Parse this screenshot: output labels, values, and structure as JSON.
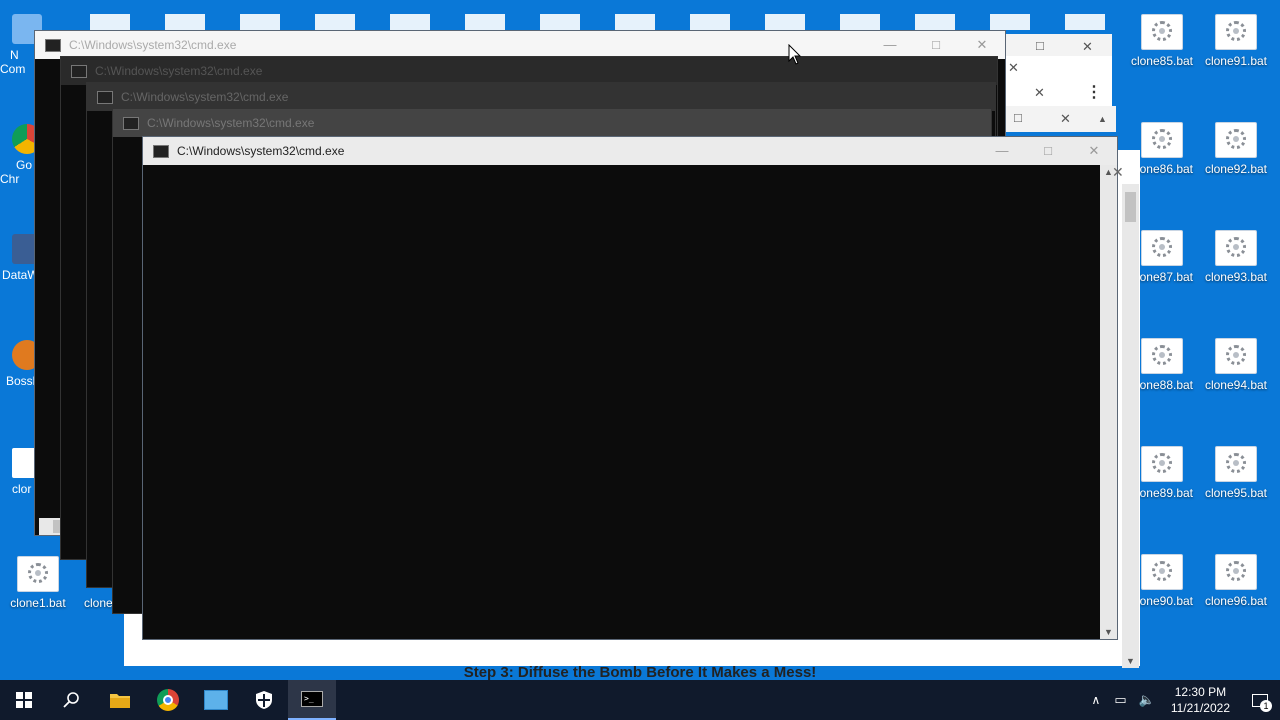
{
  "desktop": {
    "right_icons_col1": [
      "clone85.bat",
      "clone86.bat",
      "clone87.bat",
      "clone88.bat",
      "clone89.bat",
      "clone90.bat"
    ],
    "right_icons_col2": [
      "clone91.bat",
      "clone92.bat",
      "clone93.bat",
      "clone94.bat",
      "clone95.bat",
      "clone96.bat"
    ],
    "left_items": [
      {
        "label": "N\nCom",
        "name": "this-pc"
      },
      {
        "label": "Go\nChr",
        "name": "google-chrome"
      },
      {
        "label": "DataW",
        "name": "datawiper"
      },
      {
        "label": "Bossl",
        "name": "bossbus"
      },
      {
        "label": "clor",
        "name": "clone-left"
      },
      {
        "label": "clone1.bat",
        "name": "clone1"
      }
    ],
    "partial_icons": [
      "clone",
      "t"
    ]
  },
  "windows": {
    "cmd_title": "C:\\Windows\\system32\\cmd.exe",
    "controls": {
      "minimize": "—",
      "maximize": "□",
      "close": "✕"
    }
  },
  "banner": {
    "text": "Step 3: Diffuse the Bomb Before It Makes a Mess!"
  },
  "taskbar": {
    "items": [
      {
        "name": "start",
        "icon": "windows-icon"
      },
      {
        "name": "search",
        "icon": "search-icon"
      },
      {
        "name": "file-explorer",
        "icon": "folder-icon"
      },
      {
        "name": "chrome",
        "icon": "chrome-icon"
      },
      {
        "name": "control-panel",
        "icon": "app-icon"
      },
      {
        "name": "security",
        "icon": "shield-icon"
      },
      {
        "name": "cmd",
        "icon": "cmd-icon"
      }
    ],
    "time": "12:30 PM",
    "date": "11/21/2022",
    "notifications_count": "1"
  },
  "colors": {
    "desktop": "#0a78d7",
    "taskbar": "#101a2c",
    "console": "#0c0c0c"
  }
}
